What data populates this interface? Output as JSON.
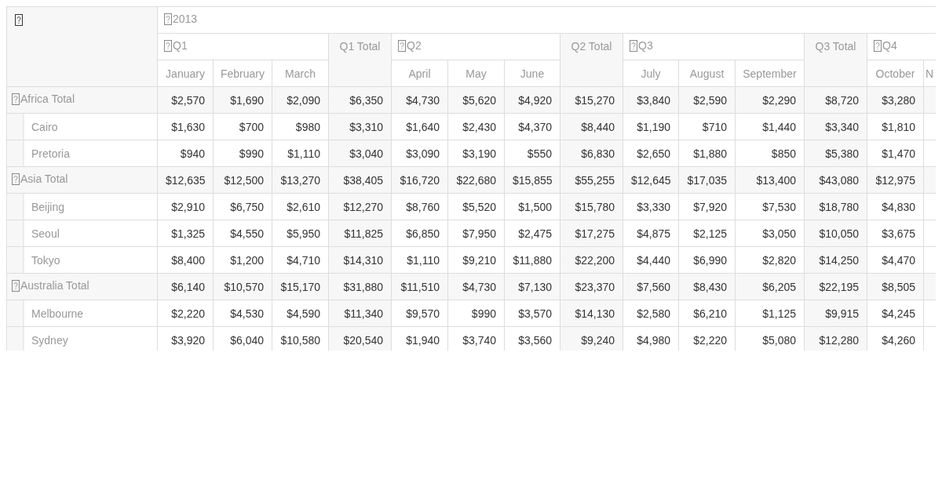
{
  "column_header": {
    "year": "2013",
    "quarters": [
      {
        "label": "Q1",
        "total": "Q1 Total",
        "months": [
          "January",
          "February",
          "March"
        ]
      },
      {
        "label": "Q2",
        "total": "Q2 Total",
        "months": [
          "April",
          "May",
          "June"
        ]
      },
      {
        "label": "Q3",
        "total": "Q3 Total",
        "months": [
          "July",
          "August",
          "September"
        ]
      },
      {
        "label": "Q4",
        "months": [
          "October",
          "N"
        ]
      }
    ]
  },
  "groups": [
    {
      "label": "Africa Total",
      "values": [
        "$2,570",
        "$1,690",
        "$2,090",
        "$6,350",
        "$4,730",
        "$5,620",
        "$4,920",
        "$15,270",
        "$3,840",
        "$2,590",
        "$2,290",
        "$8,720",
        "$3,280"
      ],
      "children": [
        {
          "label": "Cairo",
          "values": [
            "$1,630",
            "$700",
            "$980",
            "$3,310",
            "$1,640",
            "$2,430",
            "$4,370",
            "$8,440",
            "$1,190",
            "$710",
            "$1,440",
            "$3,340",
            "$1,810"
          ]
        },
        {
          "label": "Pretoria",
          "values": [
            "$940",
            "$990",
            "$1,110",
            "$3,040",
            "$3,090",
            "$3,190",
            "$550",
            "$6,830",
            "$2,650",
            "$1,880",
            "$850",
            "$5,380",
            "$1,470"
          ]
        }
      ]
    },
    {
      "label": "Asia Total",
      "values": [
        "$12,635",
        "$12,500",
        "$13,270",
        "$38,405",
        "$16,720",
        "$22,680",
        "$15,855",
        "$55,255",
        "$12,645",
        "$17,035",
        "$13,400",
        "$43,080",
        "$12,975"
      ],
      "children": [
        {
          "label": "Beijing",
          "values": [
            "$2,910",
            "$6,750",
            "$2,610",
            "$12,270",
            "$8,760",
            "$5,520",
            "$1,500",
            "$15,780",
            "$3,330",
            "$7,920",
            "$7,530",
            "$18,780",
            "$4,830"
          ]
        },
        {
          "label": "Seoul",
          "values": [
            "$1,325",
            "$4,550",
            "$5,950",
            "$11,825",
            "$6,850",
            "$7,950",
            "$2,475",
            "$17,275",
            "$4,875",
            "$2,125",
            "$3,050",
            "$10,050",
            "$3,675"
          ]
        },
        {
          "label": "Tokyo",
          "values": [
            "$8,400",
            "$1,200",
            "$4,710",
            "$14,310",
            "$1,110",
            "$9,210",
            "$11,880",
            "$22,200",
            "$4,440",
            "$6,990",
            "$2,820",
            "$14,250",
            "$4,470"
          ]
        }
      ]
    },
    {
      "label": "Australia Total",
      "values": [
        "$6,140",
        "$10,570",
        "$15,170",
        "$31,880",
        "$11,510",
        "$4,730",
        "$7,130",
        "$23,370",
        "$7,560",
        "$8,430",
        "$6,205",
        "$22,195",
        "$8,505"
      ],
      "children": [
        {
          "label": "Melbourne",
          "values": [
            "$2,220",
            "$4,530",
            "$4,590",
            "$11,340",
            "$9,570",
            "$990",
            "$3,570",
            "$14,130",
            "$2,580",
            "$6,210",
            "$1,125",
            "$9,915",
            "$4,245"
          ]
        },
        {
          "label": "Sydney",
          "values": [
            "$3,920",
            "$6,040",
            "$10,580",
            "$20,540",
            "$1,940",
            "$3,740",
            "$3,560",
            "$9,240",
            "$4,980",
            "$2,220",
            "$5,080",
            "$12,280",
            "$4,260"
          ]
        }
      ]
    }
  ]
}
